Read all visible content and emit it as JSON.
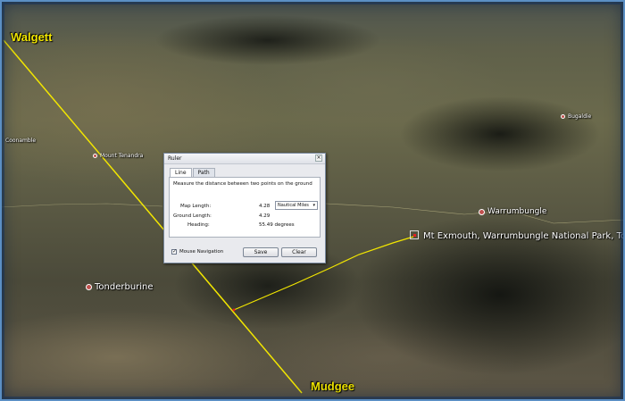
{
  "map": {
    "endpoints": {
      "start": "Walgett",
      "end": "Mudgee"
    },
    "places": {
      "mount_tenandra": "Mount Tenandra",
      "tonderburine": "Tonderburine",
      "warrumbungle": "Warrumbungle",
      "mt_exmouth": "Mt Exmouth, Warrumbungle National Park, Tc",
      "bugaldie": "Bugaldie",
      "coonamble": "Coonamble"
    },
    "colors": {
      "measure_line": "#f2e600",
      "frame": "#5b8fc4"
    }
  },
  "ruler": {
    "title": "Ruler",
    "close_icon": "close-icon",
    "tabs": [
      {
        "label": "Line",
        "active": true
      },
      {
        "label": "Path",
        "active": false
      }
    ],
    "description": "Measure the distance between two points on the ground",
    "map_length_label": "Map Length:",
    "map_length_value": "4.28",
    "units_selected": "Nautical Miles",
    "ground_length_label": "Ground Length:",
    "ground_length_value": "4.29",
    "heading_label": "Heading:",
    "heading_value": "55.49 degrees",
    "mouse_nav_label": "Mouse Navigation",
    "mouse_nav_checked": true,
    "save_label": "Save",
    "clear_label": "Clear"
  }
}
